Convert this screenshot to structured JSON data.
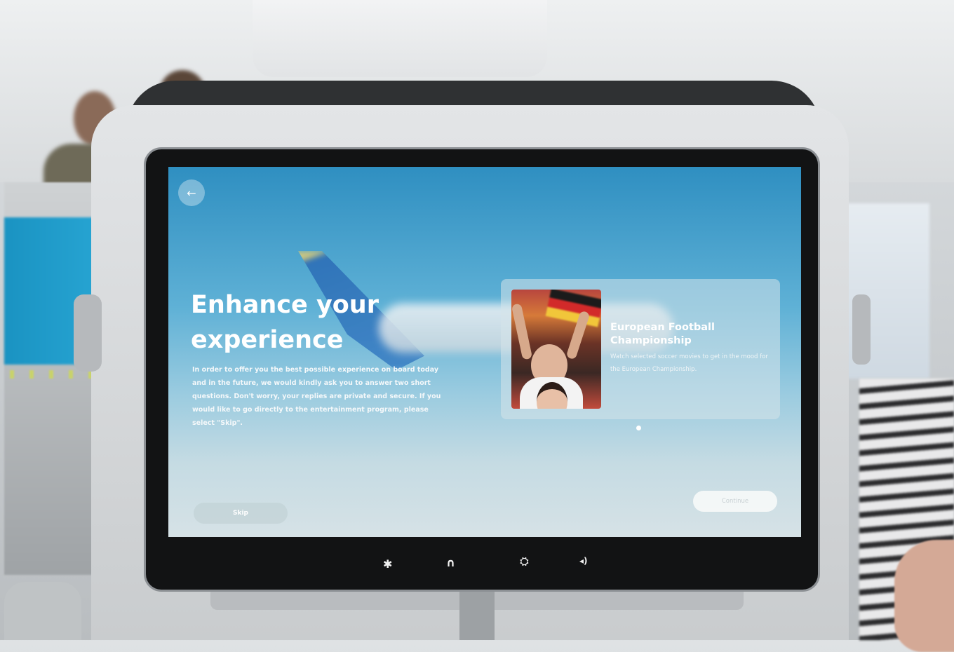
{
  "screen": {
    "back_icon": "arrow-left-icon",
    "title": "Enhance your experience",
    "intro": "In order to offer you the best possible experience on board today and in the future, we would kindly ask you to answer two short questions. Don't worry, your replies are private and secure. If you would like to go directly to the entertainment program, please select \"Skip\".",
    "card": {
      "title": "European Football Championship",
      "description": "Watch selected soccer movies to get in the mood for the European Championship."
    },
    "carousel": {
      "current": 1,
      "total": 1
    },
    "skip_label": "Skip",
    "continue_label": "Continue"
  },
  "hardware_buttons": [
    {
      "icon": "bluetooth-icon",
      "glyph": "✱"
    },
    {
      "icon": "headphones-icon",
      "glyph": "∩"
    },
    {
      "icon": "attendant-call-icon",
      "glyph": "⛭"
    },
    {
      "icon": "volume-icon",
      "glyph": "◂)"
    }
  ],
  "colors": {
    "sky_top": "#2f8fc1",
    "sky_bottom": "#d6e2e6",
    "bezel": "#121314"
  }
}
